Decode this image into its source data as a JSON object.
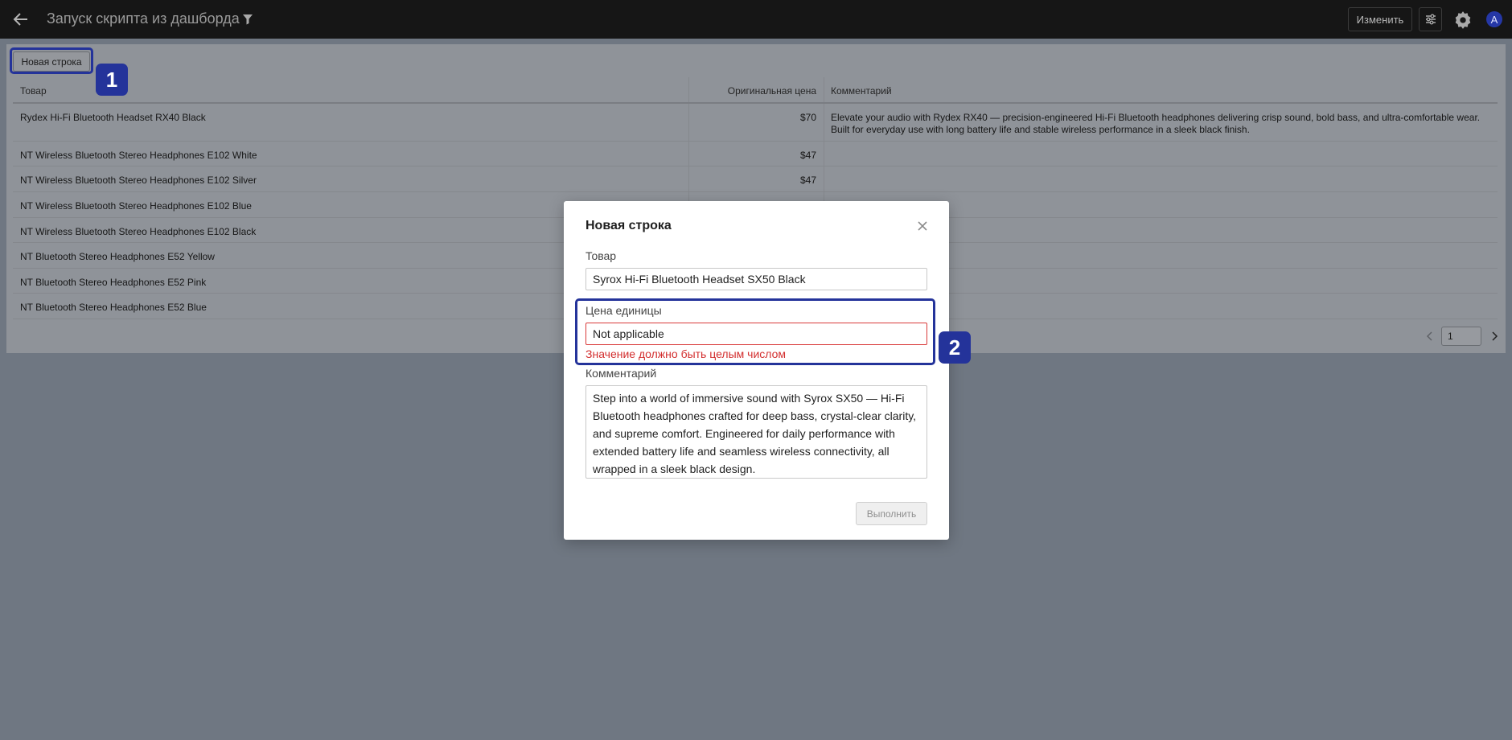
{
  "header": {
    "title": "Запуск скрипта из дашборда",
    "edit_label": "Изменить",
    "avatar_initial": "A",
    "back_icon": "arrow-left-icon",
    "filter_icon": "filter-icon",
    "sliders_icon": "sliders-icon",
    "gear_icon": "gear-icon"
  },
  "toolbar": {
    "new_row_label": "Новая строка"
  },
  "table": {
    "columns": [
      "Товар",
      "Оригинальная цена",
      "Комментарий"
    ],
    "rows": [
      {
        "product": "Rydex Hi-Fi Bluetooth Headset RX40 Black",
        "price": "$70",
        "comment": "Elevate your audio with Rydex RX40 — precision-engineered Hi-Fi Bluetooth headphones delivering crisp sound, bold bass, and ultra-comfortable wear. Built for everyday use with long battery life and stable wireless performance in a sleek black finish."
      },
      {
        "product": "NT Wireless Bluetooth Stereo Headphones E102 White",
        "price": "$47",
        "comment": ""
      },
      {
        "product": "NT Wireless Bluetooth Stereo Headphones E102 Silver",
        "price": "$47",
        "comment": ""
      },
      {
        "product": "NT Wireless Bluetooth Stereo Headphones E102 Blue",
        "price": "",
        "comment": ""
      },
      {
        "product": "NT Wireless Bluetooth Stereo Headphones E102 Black",
        "price": "",
        "comment": ""
      },
      {
        "product": "NT Bluetooth Stereo Headphones E52 Yellow",
        "price": "",
        "comment": ""
      },
      {
        "product": "NT Bluetooth Stereo Headphones E52 Pink",
        "price": "",
        "comment": ""
      },
      {
        "product": "NT Bluetooth Stereo Headphones E52 Blue",
        "price": "",
        "comment": ""
      }
    ]
  },
  "pagination": {
    "page": "1",
    "prev_icon": "chevron-left-icon",
    "next_icon": "chevron-right-icon"
  },
  "modal": {
    "title": "Новая строка",
    "close_icon": "close-icon",
    "product_label": "Товар",
    "product_value": "Syrox Hi-Fi Bluetooth Headset SX50 Black",
    "price_label": "Цена единицы",
    "price_value": "Not applicable",
    "price_error": "Значение должно быть целым числом",
    "comment_label": "Комментарий",
    "comment_value": "Step into a world of immersive sound with Syrox SX50 — Hi-Fi Bluetooth headphones crafted for deep bass, crystal-clear clarity, and supreme comfort. Engineered for daily performance with extended battery life and seamless wireless connectivity, all wrapped in a sleek black design.",
    "submit_label": "Выполнить"
  },
  "annotations": {
    "marker_1": "1",
    "marker_2": "2"
  },
  "colors": {
    "topbar": "#161616",
    "accent": "#24339a",
    "error": "#d32f2f",
    "overlay": "#6f7782"
  }
}
